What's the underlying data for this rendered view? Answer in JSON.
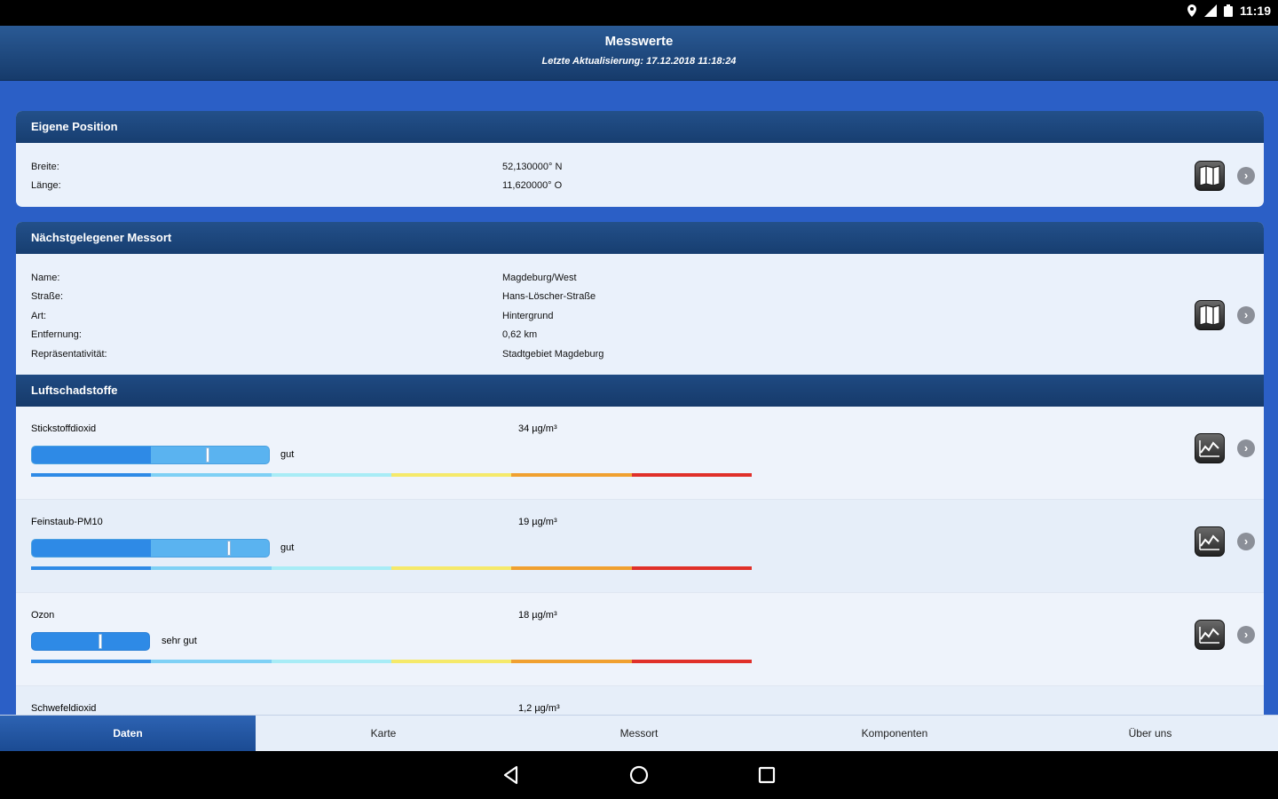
{
  "status_bar": {
    "time": "11:19"
  },
  "header": {
    "title": "Messwerte",
    "subtitle": "Letzte Aktualisierung: 17.12.2018 11:18:24"
  },
  "own_position": {
    "title": "Eigene Position",
    "rows": [
      {
        "label": "Breite:",
        "value": "52,130000° N"
      },
      {
        "label": "Länge:",
        "value": "11,620000° O"
      }
    ]
  },
  "nearest_station": {
    "title": "Nächstgelegener Messort",
    "rows": [
      {
        "label": "Name:",
        "value": "Magdeburg/West"
      },
      {
        "label": "Straße:",
        "value": "Hans-Löscher-Straße"
      },
      {
        "label": "Art:",
        "value": "Hintergrund"
      },
      {
        "label": "Entfernung:",
        "value": "0,62 km"
      },
      {
        "label": "Repräsentativität:",
        "value": "Stadtgebiet Magdeburg"
      }
    ]
  },
  "pollutants": {
    "title": "Luftschadstoffe",
    "items": [
      {
        "name": "Stickstoffdioxid",
        "value": "34 µg/m³",
        "rating": "gut",
        "level": 0.74
      },
      {
        "name": "Feinstaub-PM10",
        "value": "19 µg/m³",
        "rating": "gut",
        "level": 0.83
      },
      {
        "name": "Ozon",
        "value": "18 µg/m³",
        "rating": "sehr gut",
        "level": 0.58
      },
      {
        "name": "Schwefeldioxid",
        "value": "1,2 µg/m³",
        "rating": "",
        "level": 0
      }
    ],
    "scale_colors": [
      "#2e8ae6",
      "#7ed0f5",
      "#a8ecf6",
      "#f5e96a",
      "#f0a030",
      "#e0302a"
    ]
  },
  "tabs": [
    "Daten",
    "Karte",
    "Messort",
    "Komponenten",
    "Über uns"
  ],
  "active_tab": "Daten"
}
